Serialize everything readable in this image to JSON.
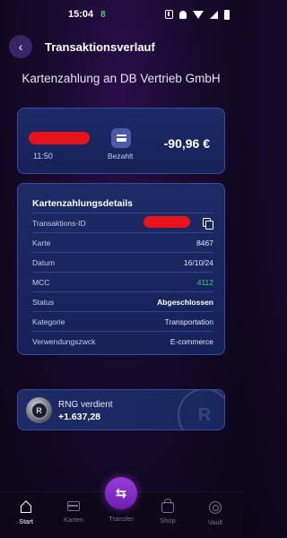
{
  "status_bar": {
    "time": "15:04",
    "badge": "8",
    "icons": [
      "nfc-icon",
      "bell-icon",
      "wifi-icon",
      "signal-icon",
      "battery-icon"
    ]
  },
  "header": {
    "back_icon": "back-arrow-icon",
    "title": "Transaktionsverlauf"
  },
  "merchant": "Kartenzahlung an DB Vertrieb GmbH",
  "summary": {
    "time": "11:50",
    "status_icon": "card-icon",
    "status_label": "Bezahlt",
    "amount": "-90,96 €",
    "amount_color": "#ffffff"
  },
  "details": {
    "title": "Kartenzahlungsdetails",
    "rows": [
      {
        "label": "Transaktions-ID",
        "value": ""
      },
      {
        "label": "Karte",
        "value": "8467"
      },
      {
        "label": "Datum",
        "value": "16/10/24"
      },
      {
        "label": "MCC",
        "value": "4112"
      },
      {
        "label": "Status",
        "value": "Abgeschlossen"
      },
      {
        "label": "Kategorie",
        "value": "Transportation"
      },
      {
        "label": "Verwendungszwck",
        "value": "E-commerce"
      }
    ],
    "mcc_color": "#3fd07a"
  },
  "rewards": {
    "title": "RNG verdient",
    "amount": "+1.637,28",
    "icon": "rng-coin-icon"
  },
  "nav": {
    "items": [
      {
        "label": "Start",
        "icon": "home-icon",
        "active": true
      },
      {
        "label": "Karten",
        "icon": "card-icon",
        "active": false
      },
      {
        "label": "Transfer",
        "icon": "transfer-icon",
        "active": false
      },
      {
        "label": "Shop",
        "icon": "shop-bag-icon",
        "active": false
      },
      {
        "label": "Vault",
        "icon": "vault-icon",
        "active": false
      }
    ]
  },
  "colors": {
    "accent": "#9b3ad8",
    "card_bg": "#1c2a66",
    "positive": "#3fd07a"
  }
}
